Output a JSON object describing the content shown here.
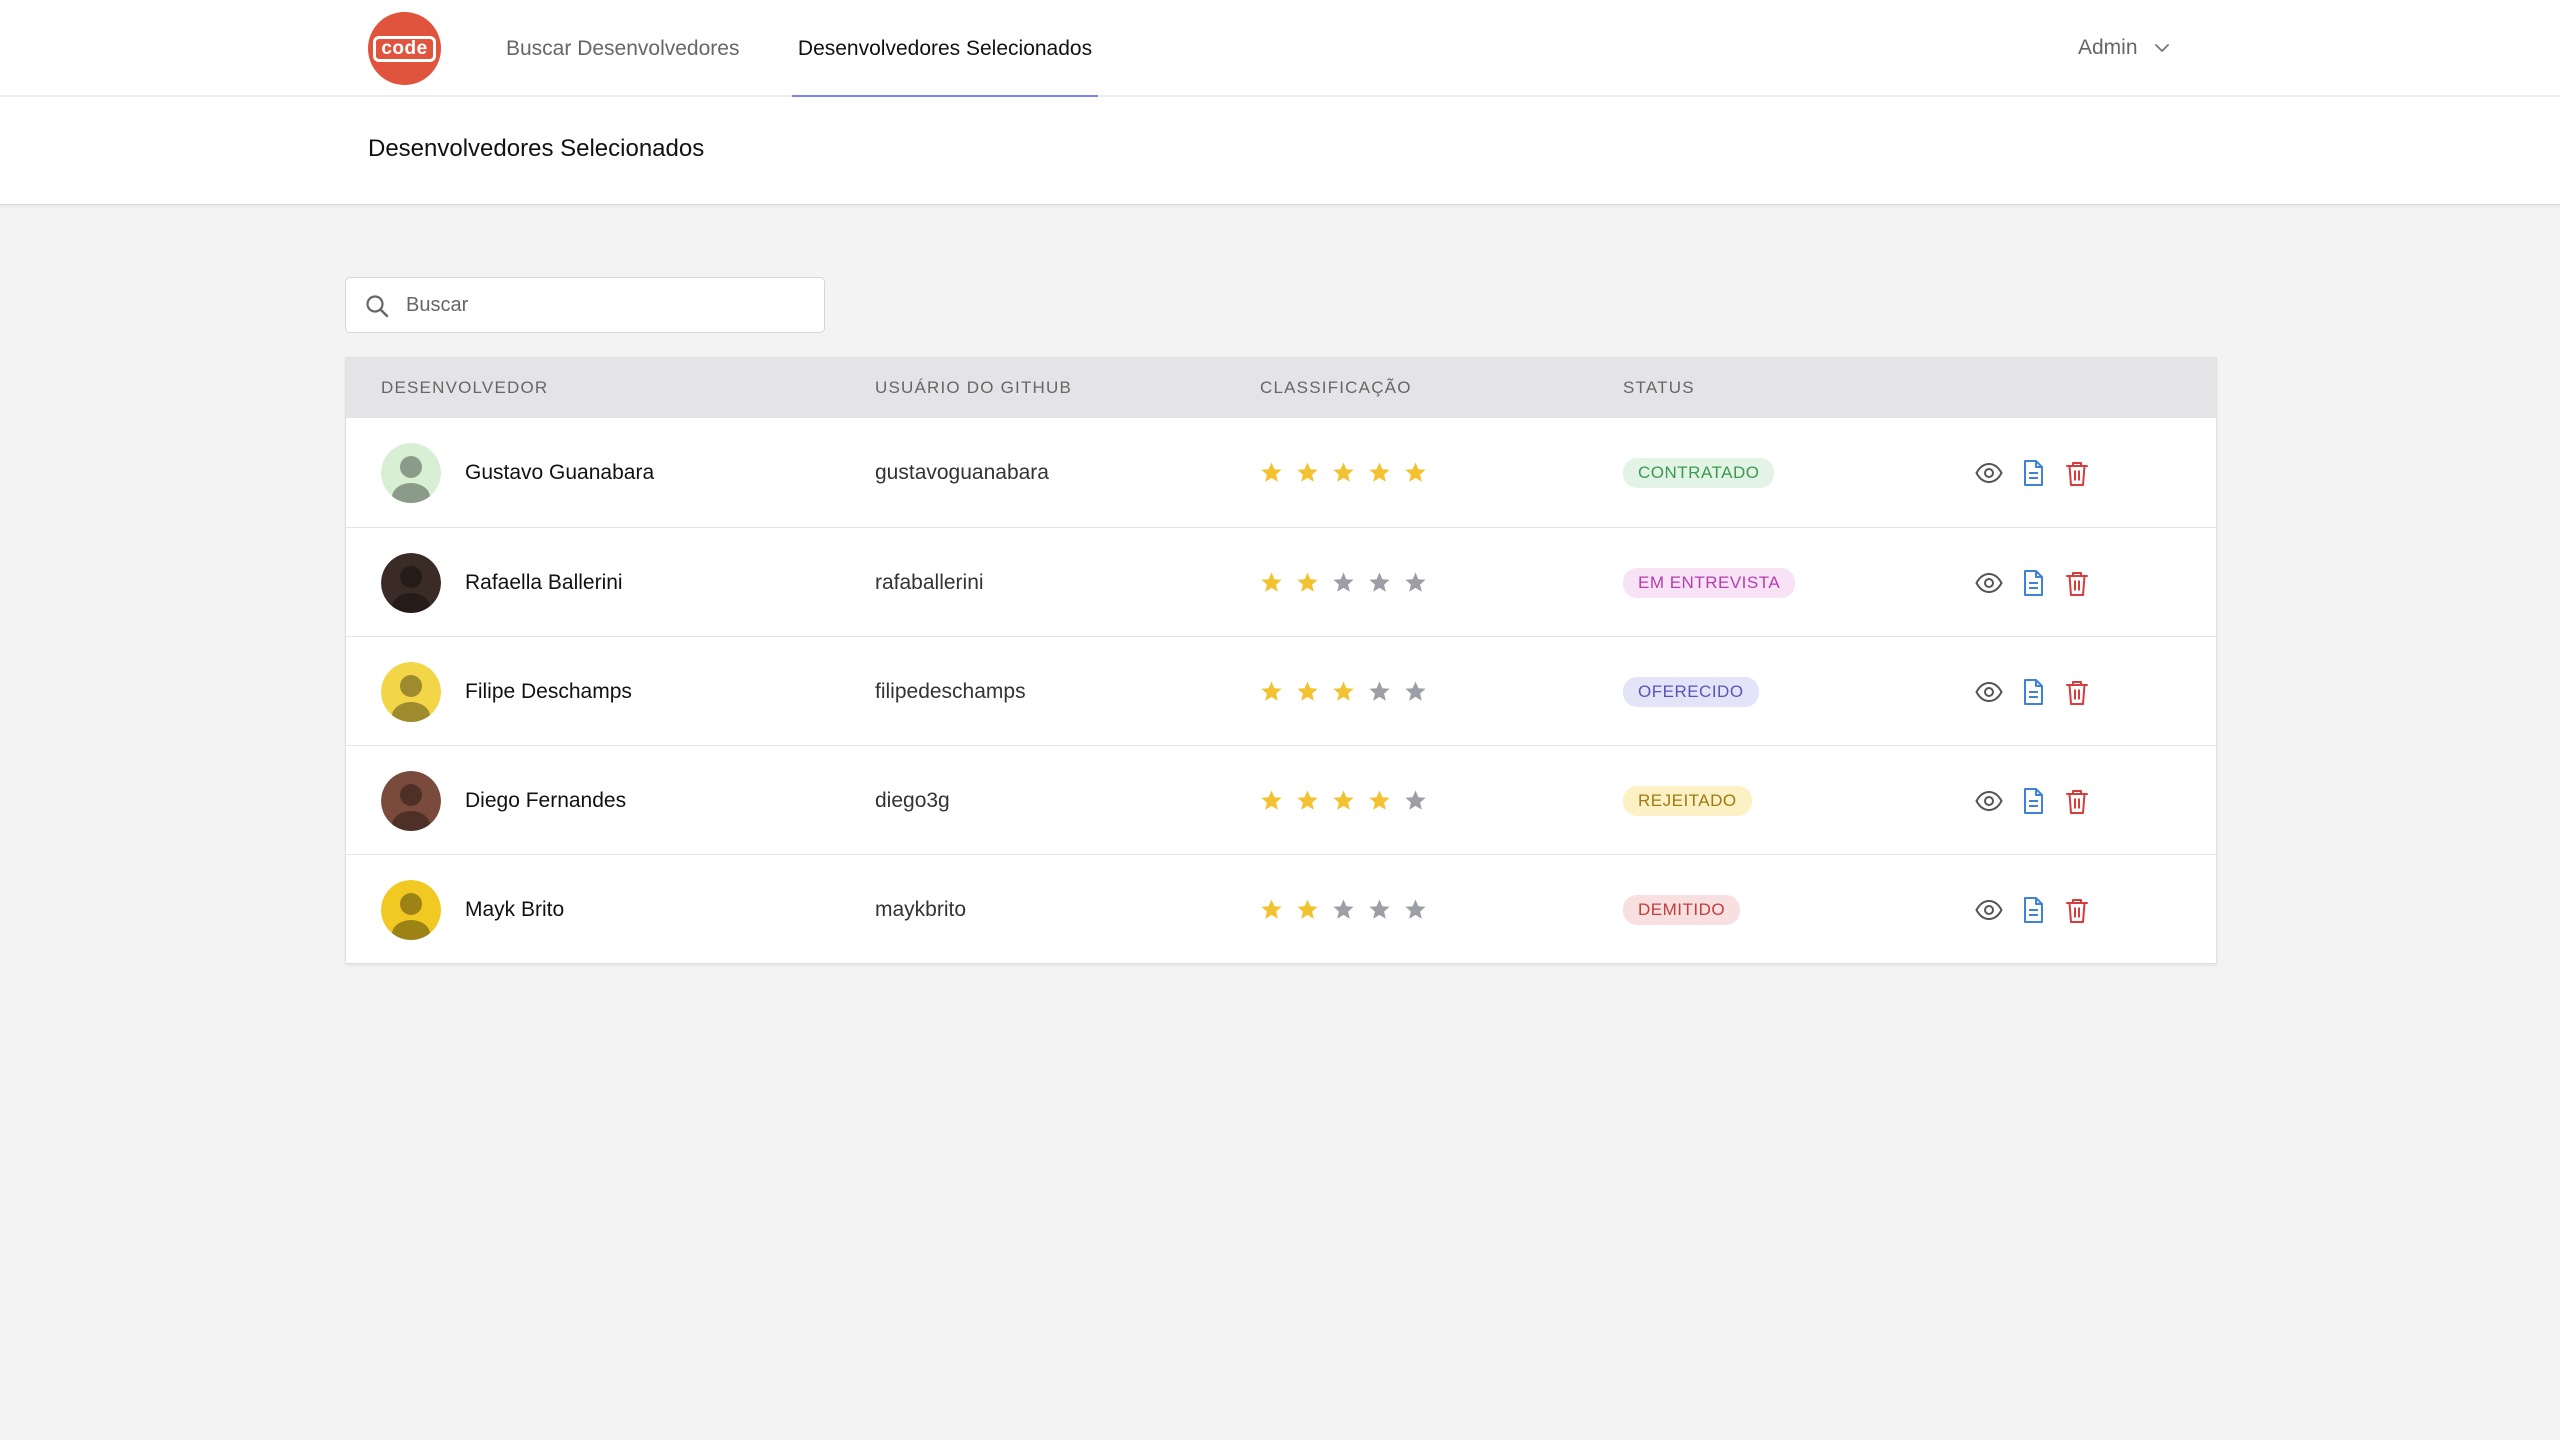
{
  "app": {
    "logo_text": "code",
    "brand_color": "#e0533d"
  },
  "nav": {
    "tabs": [
      {
        "label": "Buscar Desenvolvedores",
        "active": false
      },
      {
        "label": "Desenvolvedores Selecionados",
        "active": true
      }
    ],
    "user_menu": {
      "label": "Admin",
      "icon": "chevron-down-icon"
    }
  },
  "page": {
    "title": "Desenvolvedores Selecionados"
  },
  "search": {
    "placeholder": "Buscar",
    "value": "",
    "icon": "search-icon"
  },
  "table": {
    "headers": [
      "DESENVOLVEDOR",
      "USUÁRIO DO GITHUB",
      "CLASSIFICAÇÃO",
      "STATUS"
    ],
    "rows": [
      {
        "name": "Gustavo Guanabara",
        "github": "gustavoguanabara",
        "rating": 5,
        "status": "CONTRATADO",
        "status_color": "#3a9a4d",
        "status_bg": "#e3f4e6",
        "avatar_bg": "#d8efd3"
      },
      {
        "name": "Rafaella Ballerini",
        "github": "rafaballerini",
        "rating": 2,
        "status": "EM ENTREVISTA",
        "status_color": "#b43fae",
        "status_bg": "#f8e2f5",
        "avatar_bg": "#3a2b27"
      },
      {
        "name": "Filipe Deschamps",
        "github": "filipedeschamps",
        "rating": 3,
        "status": "OFERECIDO",
        "status_color": "#5b54b8",
        "status_bg": "#e4e4f8",
        "avatar_bg": "#f2d648"
      },
      {
        "name": "Diego Fernandes",
        "github": "diego3g",
        "rating": 4,
        "status": "REJEITADO",
        "status_color": "#a07a0e",
        "status_bg": "#fbf1c4",
        "avatar_bg": "#7a4a3c"
      },
      {
        "name": "Mayk Brito",
        "github": "maykbrito",
        "rating": 2,
        "status": "DEMITIDO",
        "status_color": "#c43c3c",
        "status_bg": "#f9e0e0",
        "avatar_bg": "#f2c823"
      }
    ],
    "actions": [
      "eye-icon",
      "document-icon",
      "trash-icon"
    ]
  },
  "colors": {
    "star_filled": "#f2c230",
    "star_empty": "#9e9fa6",
    "view_icon": "#555555",
    "doc_icon": "#3d82d6",
    "trash_icon": "#d83b3b",
    "active_tab_underline": "#7c85e6"
  }
}
